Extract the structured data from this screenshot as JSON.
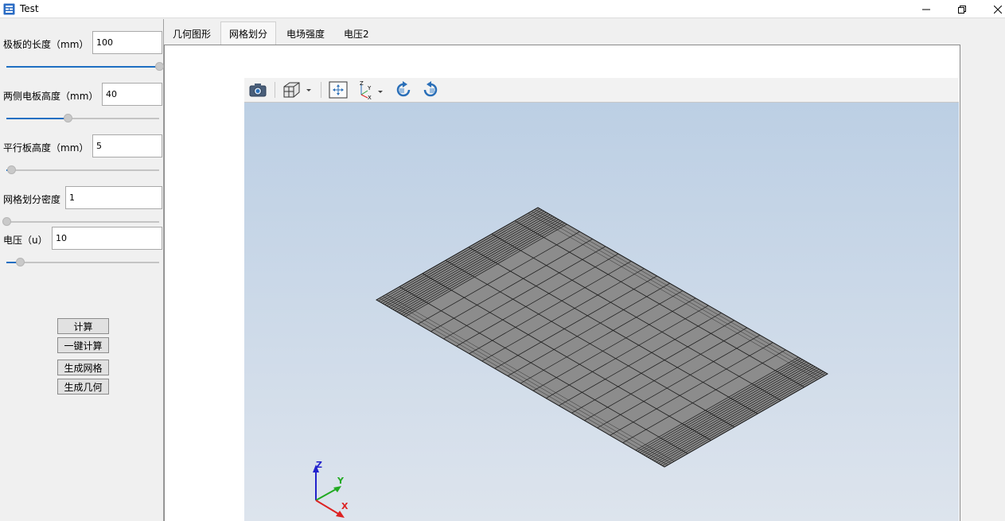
{
  "window": {
    "title": "Test"
  },
  "params": [
    {
      "label": "极板的长度（mm）",
      "value": "100",
      "slider_fraction": 1.0
    },
    {
      "label": "两侧电板高度（mm）",
      "value": "40",
      "slider_fraction": 0.4
    },
    {
      "label": "平行板高度（mm）",
      "value": "5",
      "slider_fraction": 0.03
    },
    {
      "label": "网格划分密度",
      "value": "1",
      "slider_fraction": 0.0
    },
    {
      "label": "电压（u）",
      "value": "10",
      "slider_fraction": 0.09
    }
  ],
  "buttons": {
    "calc": "计算",
    "one_click_calc": "一键计算",
    "gen_mesh": "生成网格",
    "gen_geometry": "生成几何"
  },
  "tabs": [
    {
      "label": "几何图形",
      "active": false
    },
    {
      "label": "网格划分",
      "active": true
    },
    {
      "label": "电场强度",
      "active": false
    },
    {
      "label": "电压2",
      "active": false
    }
  ],
  "viewer": {
    "toolbar_icons": [
      "camera-icon",
      "view-cube-icon",
      "fit-all-icon",
      "axes-orientation-icon",
      "rotate-left-icon",
      "rotate-right-icon"
    ],
    "axis_labels": {
      "x": "X",
      "y": "Y",
      "z": "Z"
    },
    "mini_axis_labels": {
      "x": "X",
      "y": "Y",
      "z": "Z"
    },
    "colors": {
      "mesh_fill": "#8c8c8c",
      "mesh_line": "#1a1a1a",
      "bg_top": "#bccfe4",
      "bg_bottom": "#dde4ed"
    }
  }
}
